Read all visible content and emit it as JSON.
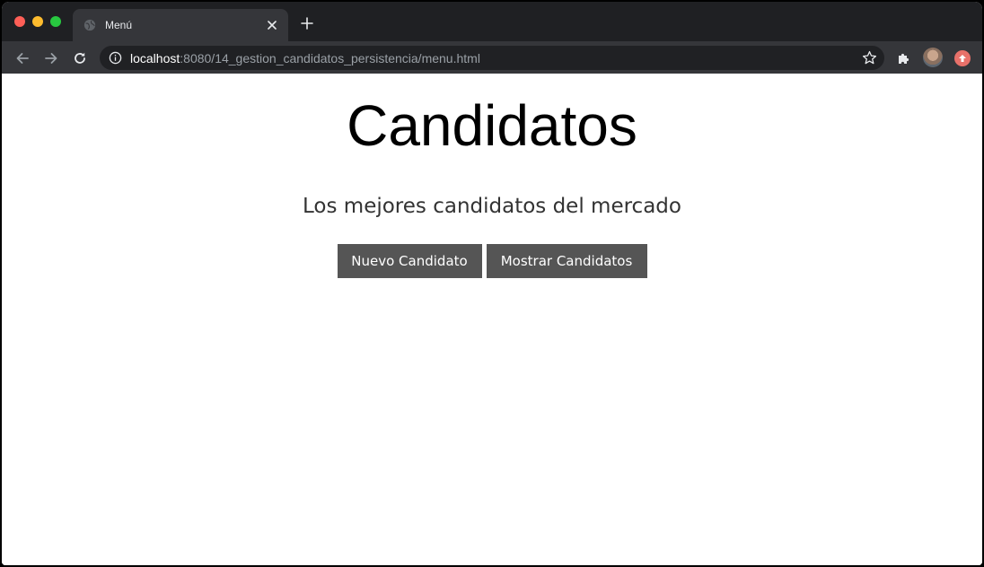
{
  "browser": {
    "tab": {
      "title": "Menú",
      "icon": "globe-icon"
    },
    "address_bar": {
      "host": "localhost",
      "path": ":8080/14_gestion_candidatos_persistencia/menu.html"
    },
    "colors": {
      "titlebar": "#1f2023",
      "toolbar": "#35363a",
      "omnibox": "#202124"
    }
  },
  "page": {
    "heading": "Candidatos",
    "subtitle": "Los mejores candidatos del mercado",
    "buttons": {
      "new_label": "Nuevo Candidato",
      "show_label": "Mostrar Candidatos"
    },
    "colors": {
      "button_bg": "#555555",
      "button_text": "#ffffff",
      "background": "#ffffff"
    }
  }
}
